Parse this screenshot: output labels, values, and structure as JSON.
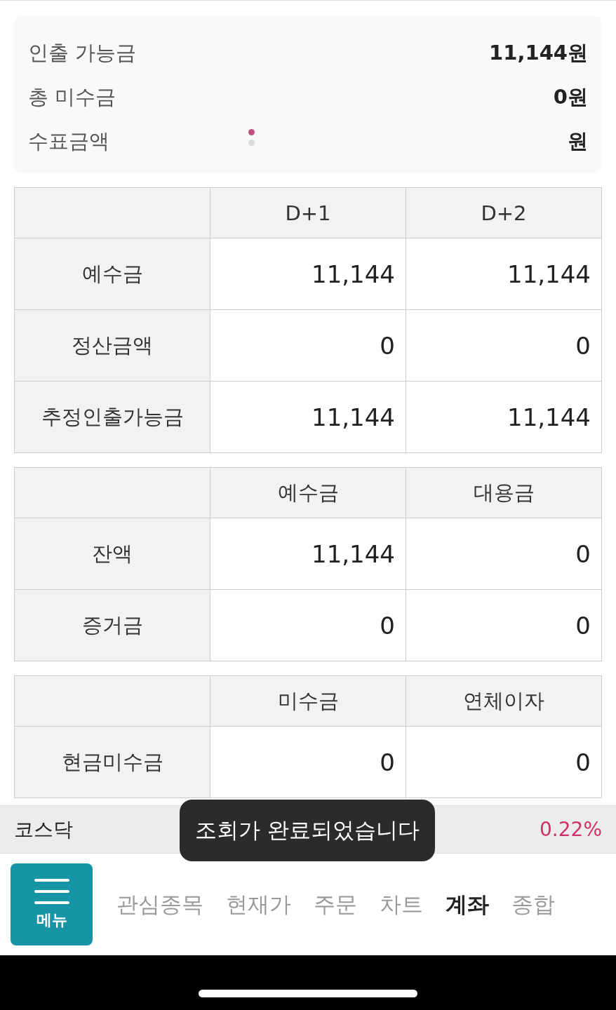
{
  "summary": {
    "rows": [
      {
        "label": "인출 가능금",
        "value": "11,144원"
      },
      {
        "label": "총 미수금",
        "value": "0원"
      },
      {
        "label": "수표금액",
        "value": "원"
      }
    ],
    "pager": [
      {
        "selected": true
      },
      {
        "selected": false
      }
    ]
  },
  "tables": [
    {
      "columns": [
        "D+1",
        "D+2"
      ],
      "rows": [
        {
          "label": "예수금",
          "values": [
            "11,144",
            "11,144"
          ]
        },
        {
          "label": "정산금액",
          "values": [
            "0",
            "0"
          ]
        },
        {
          "label": "추정인출가능금",
          "values": [
            "11,144",
            "11,144"
          ]
        }
      ]
    },
    {
      "columns": [
        "예수금",
        "대용금"
      ],
      "rows": [
        {
          "label": "잔액",
          "values": [
            "11,144",
            "0"
          ]
        },
        {
          "label": "증거금",
          "values": [
            "0",
            "0"
          ]
        }
      ]
    },
    {
      "columns": [
        "미수금",
        "연체이자"
      ],
      "rows": [
        {
          "label": "현금미수금",
          "values": [
            "0",
            "0"
          ]
        }
      ]
    }
  ],
  "ticker": {
    "name": "코스닥",
    "change": "0.22%"
  },
  "toast": "조회가 완료되었습니다",
  "nav": {
    "menu_label": "메뉴",
    "tabs": [
      {
        "label": "관심종목",
        "selected": false
      },
      {
        "label": "현재가",
        "selected": false
      },
      {
        "label": "주문",
        "selected": false
      },
      {
        "label": "차트",
        "selected": false
      },
      {
        "label": "계좌",
        "selected": true
      },
      {
        "label": "종합",
        "selected": false
      }
    ]
  }
}
